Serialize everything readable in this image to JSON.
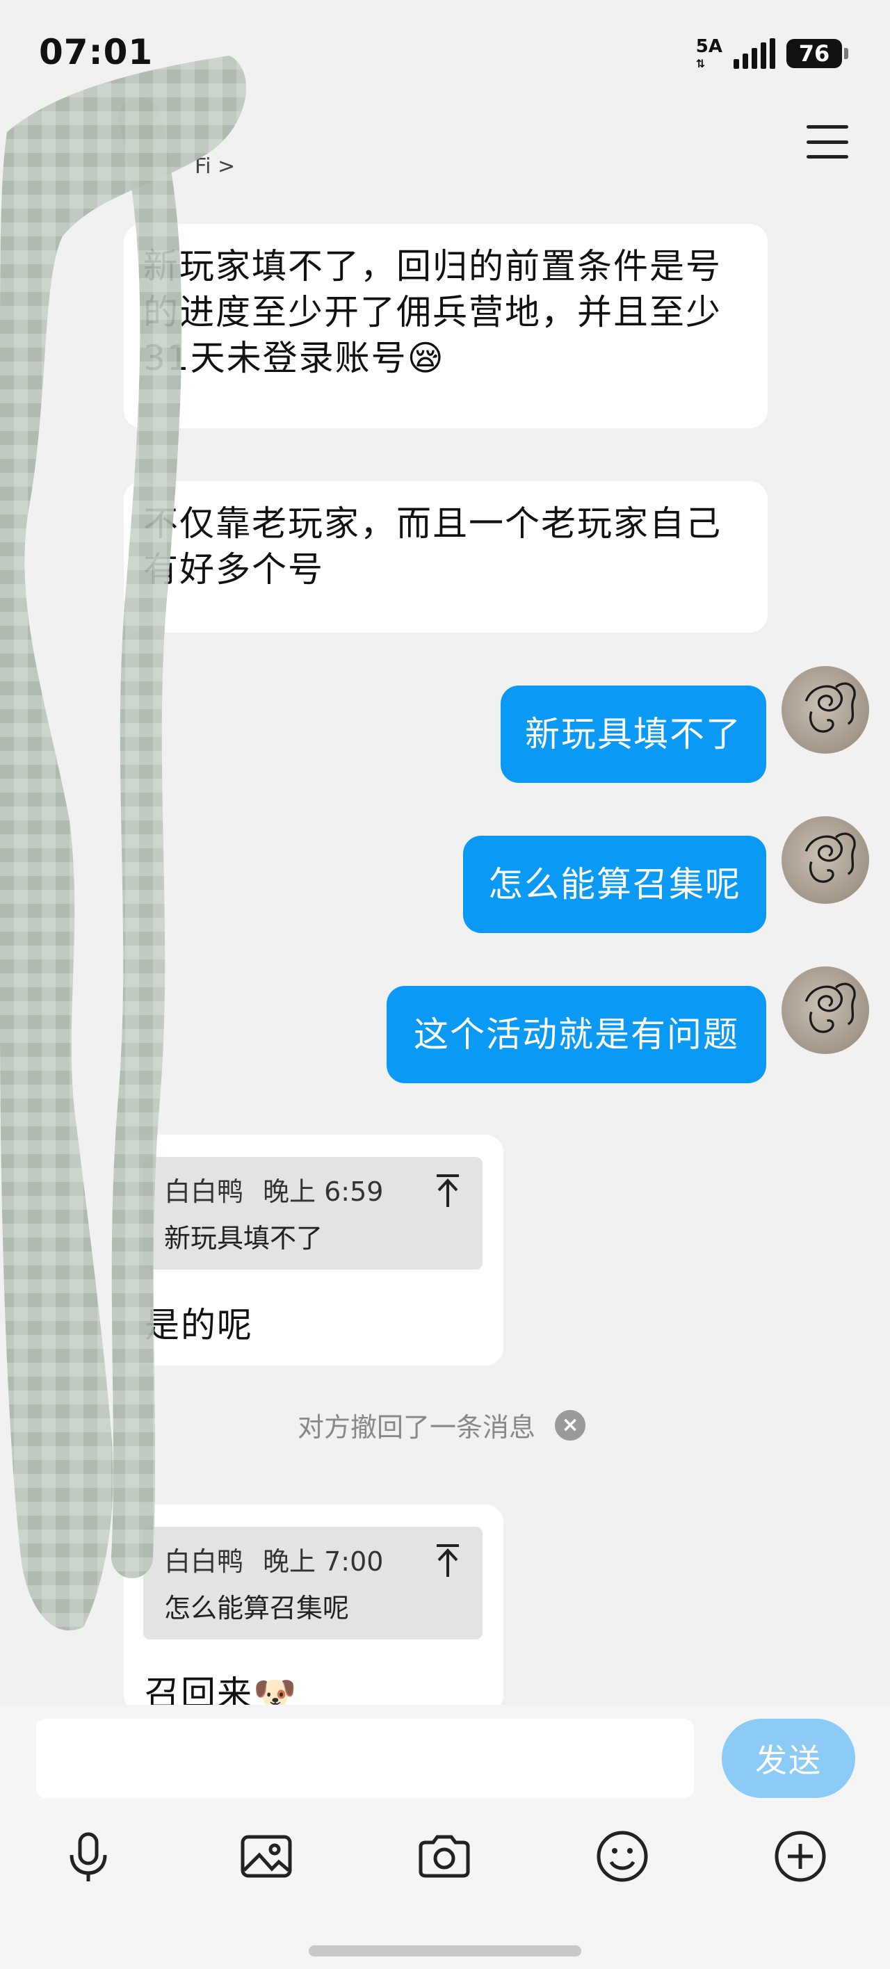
{
  "status_bar": {
    "time": "07:01",
    "network": "5A",
    "battery": "76"
  },
  "header": {
    "subtitle": "Fi >"
  },
  "messages": {
    "m1": {
      "line1": "新玩家填不了，回归的前置条件是号",
      "line2": "的进度至少开了佣兵营地，并且至少",
      "line3": "31天未登录账号😪"
    },
    "m2": {
      "line1": "不仅靠老玩家，而且一个老玩家自己",
      "line2": "有好多个号"
    },
    "m3": {
      "text": "新玩具填不了"
    },
    "m4": {
      "text": "怎么能算召集呢"
    },
    "m5": {
      "text": "这个活动就是有问题"
    },
    "m6": {
      "quote_sender": "白白鸭",
      "quote_time": "晚上 6:59",
      "quote_text": "新玩具填不了",
      "reply": "是的呢"
    },
    "recall_notice": "对方撤回了一条消息",
    "m7": {
      "quote_sender": "白白鸭",
      "quote_time": "晚上 7:00",
      "quote_text": "怎么能算召集呢",
      "reply": "召回来🐶"
    }
  },
  "composer": {
    "input_value": "",
    "send_label": "发送"
  },
  "toolbar_icons": [
    "microphone-icon",
    "image-icon",
    "camera-icon",
    "emoji-icon",
    "plus-icon"
  ],
  "colors": {
    "outgoing_bubble": "#0a99f5",
    "send_button": "#8ccbf6",
    "background": "#f1f1f1"
  }
}
